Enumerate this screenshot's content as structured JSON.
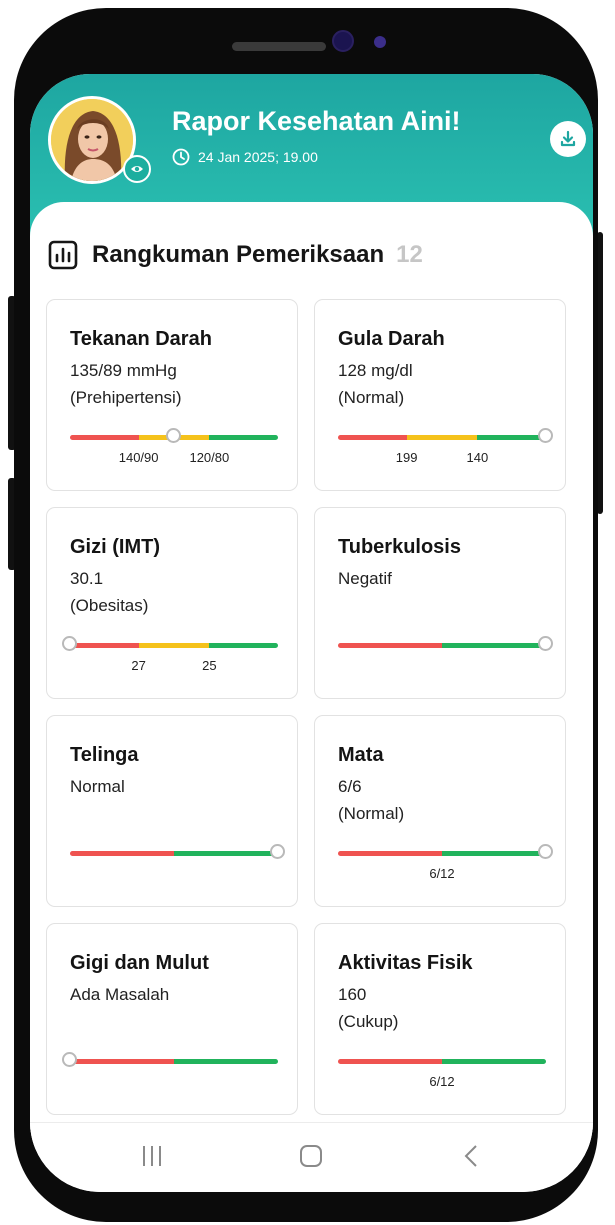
{
  "header": {
    "title": "Rapor Kesehatan Aini!",
    "datetime": "24 Jan 2025; 19.00"
  },
  "summary": {
    "title": "Rangkuman Pemeriksaan",
    "count": "12"
  },
  "colors": {
    "red": "#ef5350",
    "yellow": "#f5c21b",
    "green": "#21b35c",
    "teal": "#1ea6a1"
  },
  "cards": [
    {
      "title": "Tekanan Darah",
      "value": "135/89 mmHg",
      "status": "(Prehipertensi)",
      "segments": [
        "red",
        "yellow",
        "green"
      ],
      "segment_widths": [
        0.33,
        0.34,
        0.33
      ],
      "marker_position": 0.5,
      "ticks": [
        "140/90",
        "120/80"
      ]
    },
    {
      "title": "Gula Darah",
      "value": "128 mg/dl",
      "status": "(Normal)",
      "segments": [
        "red",
        "yellow",
        "green"
      ],
      "segment_widths": [
        0.33,
        0.34,
        0.33
      ],
      "marker_position": 1.0,
      "ticks": [
        "199",
        "140"
      ]
    },
    {
      "title": "Gizi (IMT)",
      "value": "30.1",
      "status": "(Obesitas)",
      "segments": [
        "red",
        "yellow",
        "green"
      ],
      "segment_widths": [
        0.33,
        0.34,
        0.33
      ],
      "marker_position": 0.0,
      "ticks": [
        "27",
        "25"
      ]
    },
    {
      "title": "Tuberkulosis",
      "value": "Negatif",
      "status": "",
      "segments": [
        "red",
        "green"
      ],
      "segment_widths": [
        0.5,
        0.5
      ],
      "marker_position": 1.0,
      "ticks": []
    },
    {
      "title": "Telinga",
      "value": "Normal",
      "status": "",
      "segments": [
        "red",
        "green"
      ],
      "segment_widths": [
        0.5,
        0.5
      ],
      "marker_position": 1.0,
      "ticks": []
    },
    {
      "title": "Mata",
      "value": "6/6",
      "status": "(Normal)",
      "segments": [
        "red",
        "green"
      ],
      "segment_widths": [
        0.5,
        0.5
      ],
      "marker_position": 1.0,
      "ticks": [
        "6/12"
      ]
    },
    {
      "title": "Gigi dan Mulut",
      "value": "Ada Masalah",
      "status": "",
      "segments": [
        "red",
        "green"
      ],
      "segment_widths": [
        0.5,
        0.5
      ],
      "marker_position": 0.0,
      "ticks": []
    },
    {
      "title": "Aktivitas Fisik",
      "value": "160",
      "status": "(Cukup)",
      "segments": [
        "red",
        "green"
      ],
      "segment_widths": [
        0.5,
        0.5
      ],
      "marker_position": null,
      "ticks": [
        "6/12"
      ]
    }
  ],
  "navbar": {
    "icons": [
      "recent-apps-icon",
      "home-icon",
      "back-icon"
    ]
  }
}
